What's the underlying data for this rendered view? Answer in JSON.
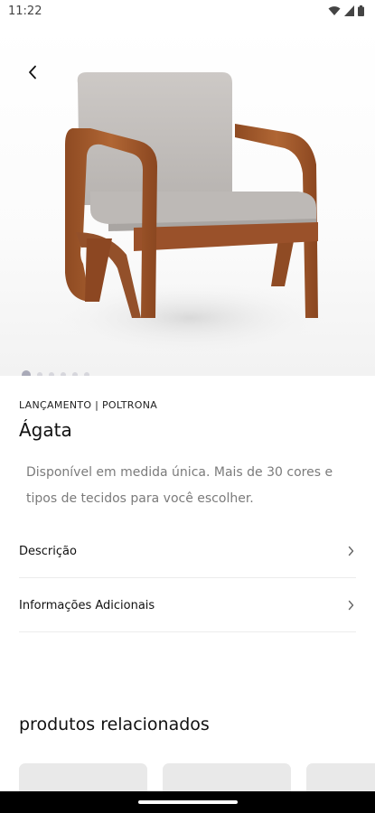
{
  "status_bar": {
    "time": "11:22",
    "icons": [
      "wifi-icon",
      "signal-icon",
      "battery-icon"
    ]
  },
  "gallery": {
    "image": "armchair-photo",
    "total_images": 6,
    "active_index": 0
  },
  "product": {
    "category": "LANÇAMENTO | POLTRONA",
    "name": "Ágata",
    "description": "Disponível em medida única. Mais de 30 cores e tipos de tecidos para você escolher."
  },
  "sections": [
    {
      "label": "Descrição"
    },
    {
      "label": "Informações Adicionais"
    }
  ],
  "related": {
    "title": "produtos relacionados"
  },
  "colors": {
    "dot_active": "#a9aab8",
    "dot_inactive": "#d6d6dc",
    "wood": "#a55a2c",
    "fabric": "#c3bfbb"
  }
}
